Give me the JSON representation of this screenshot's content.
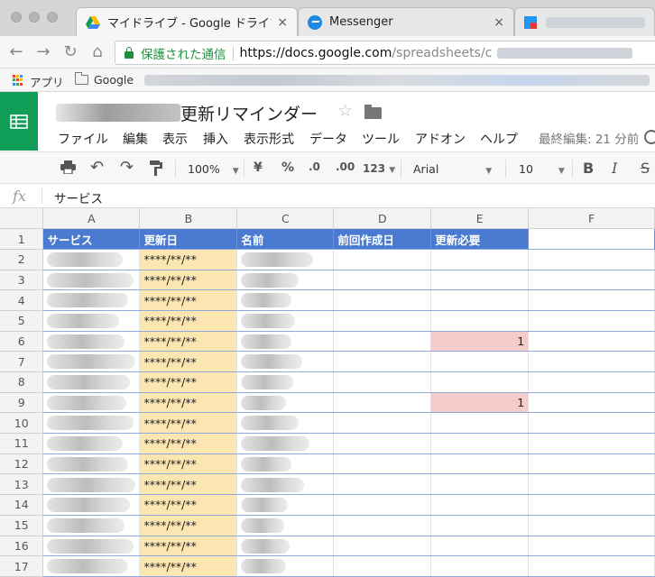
{
  "browser": {
    "tabs": [
      {
        "title": "マイドライブ - Google ドライブ",
        "close": "×",
        "icon": "google-drive-icon"
      },
      {
        "title": "Messenger",
        "close": "×",
        "icon": "messenger-icon"
      },
      {
        "title": "",
        "close": "",
        "icon": "google-sheets-icon"
      }
    ],
    "secure_label": "保護された通信",
    "url_host": "https://docs.google.com",
    "url_path": "/spreadsheets/c",
    "bookmarks": [
      {
        "label": "アプリ",
        "icon": "apps-grid-icon"
      },
      {
        "label": "Google",
        "icon": "folder-icon"
      }
    ]
  },
  "sheet": {
    "title_suffix": "更新リマインダー",
    "menu": [
      "ファイル",
      "編集",
      "表示",
      "挿入",
      "表示形式",
      "データ",
      "ツール",
      "アドオン",
      "ヘルプ"
    ],
    "last_edit": "最終編集: 21 分前"
  },
  "format_toolbar": {
    "zoom": "100%",
    "currency": "¥",
    "percent": "%",
    "dec_less": ".0",
    "dec_more": ".00",
    "more_formats": "123",
    "font": "Arial",
    "font_size": "10",
    "bold": "B",
    "italic": "I",
    "strike": "S"
  },
  "formula_bar": {
    "fx": "fx",
    "content": "サービス"
  },
  "grid": {
    "columns": [
      "A",
      "B",
      "C",
      "D",
      "E",
      "F"
    ],
    "header_row": {
      "number": "1",
      "cells": [
        "サービス",
        "更新日",
        "名前",
        "前回作成日",
        "更新必要",
        ""
      ]
    },
    "rows": [
      {
        "number": "2",
        "date": "****/**/**",
        "flag": ""
      },
      {
        "number": "3",
        "date": "****/**/**",
        "flag": ""
      },
      {
        "number": "4",
        "date": "****/**/**",
        "flag": ""
      },
      {
        "number": "5",
        "date": "****/**/**",
        "flag": ""
      },
      {
        "number": "6",
        "date": "****/**/**",
        "flag": "1"
      },
      {
        "number": "7",
        "date": "****/**/**",
        "flag": ""
      },
      {
        "number": "8",
        "date": "****/**/**",
        "flag": ""
      },
      {
        "number": "9",
        "date": "****/**/**",
        "flag": "1"
      },
      {
        "number": "10",
        "date": "****/**/**",
        "flag": ""
      },
      {
        "number": "11",
        "date": "****/**/**",
        "flag": ""
      },
      {
        "number": "12",
        "date": "****/**/**",
        "flag": ""
      },
      {
        "number": "13",
        "date": "****/**/**",
        "flag": ""
      },
      {
        "number": "14",
        "date": "****/**/**",
        "flag": ""
      },
      {
        "number": "15",
        "date": "****/**/**",
        "flag": ""
      },
      {
        "number": "16",
        "date": "****/**/**",
        "flag": ""
      },
      {
        "number": "17",
        "date": "****/**/**",
        "flag": ""
      }
    ]
  },
  "colors": {
    "sheets_green": "#0f9d58",
    "header_blue": "#4a7bd1",
    "date_yellow": "#fbe5b1",
    "flag_pink": "#f4cccc",
    "secure_green": "#1e8e3e"
  }
}
